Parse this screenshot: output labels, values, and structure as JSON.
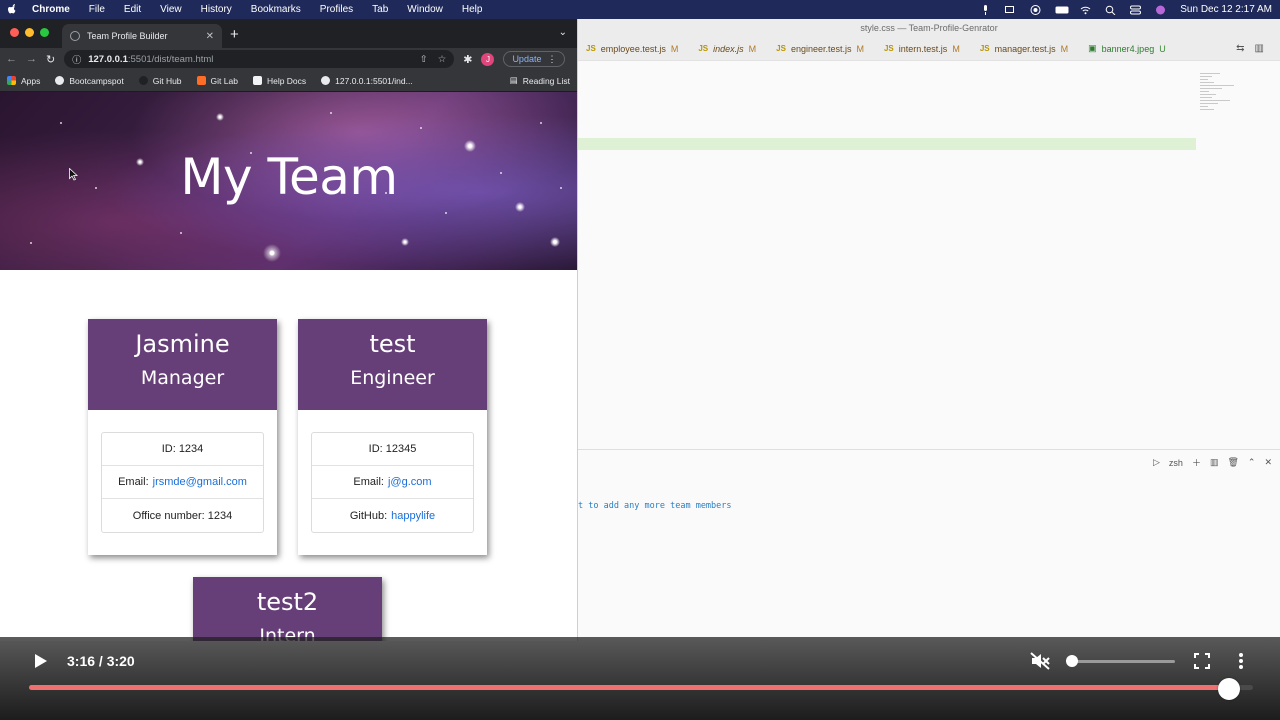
{
  "menubar": {
    "app": "Chrome",
    "items": [
      "File",
      "Edit",
      "View",
      "History",
      "Bookmarks",
      "Profiles",
      "Tab",
      "Window",
      "Help"
    ],
    "clock": "Sun Dec 12  2:17 AM"
  },
  "vscode": {
    "window_title": "style.css — Team-Profile-Genrator",
    "tabs": [
      {
        "label": "employee.test.js",
        "status": "M"
      },
      {
        "label": "index.js",
        "status": "M"
      },
      {
        "label": "engineer.test.js",
        "status": "M"
      },
      {
        "label": "intern.test.js",
        "status": "M"
      },
      {
        "label": "manager.test.js",
        "status": "M"
      },
      {
        "label": "banner4.jpeg",
        "status": "U"
      }
    ],
    "terminal_shell": "zsh",
    "terminal_line": "t to add any more team members"
  },
  "browser": {
    "tab_title": "Team Profile Builder",
    "url_host": "127.0.0.1",
    "url_path": ":5501/dist/team.html",
    "avatar_letter": "J",
    "update_label": "Update",
    "bookmarks": [
      "Apps",
      "Bootcampspot",
      "Git Hub",
      "Git Lab",
      "Help Docs",
      "127.0.0.1:5501/ind..."
    ],
    "reading_list": "Reading List"
  },
  "page": {
    "title": "My Team",
    "cards": [
      {
        "name": "Jasmine",
        "role": "Manager",
        "id_text": "ID: 1234",
        "email_label": "Email:",
        "email": "jrsmde@gmail.com",
        "extra_label": "Office number: 1234",
        "extra_link": ""
      },
      {
        "name": "test",
        "role": "Engineer",
        "id_text": "ID: 12345",
        "email_label": "Email:",
        "email": "j@g.com",
        "extra_label": "GitHub:",
        "extra_link": "happylife"
      },
      {
        "name": "test2",
        "role": "Intern"
      }
    ],
    "card_header_color": "#663f78"
  },
  "player": {
    "time": "3:16 / 3:20",
    "progress_fraction": 0.98,
    "volume_fraction": 0.0,
    "muted": true,
    "accent": "#f07070"
  }
}
